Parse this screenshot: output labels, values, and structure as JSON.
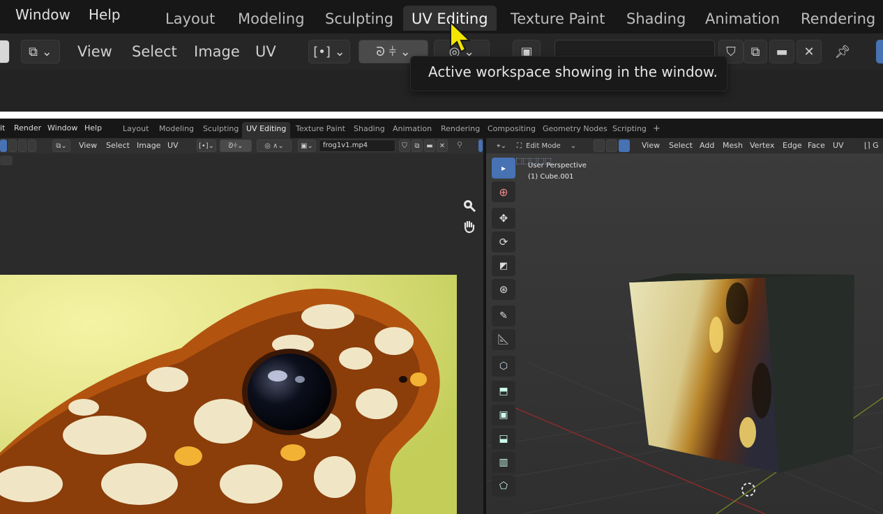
{
  "zoom": {
    "menu": [
      "Window",
      "Help"
    ],
    "tabs": [
      {
        "label": "Layout",
        "active": false
      },
      {
        "label": "Modeling",
        "active": false
      },
      {
        "label": "Sculpting",
        "active": false
      },
      {
        "label": "UV Editing",
        "active": true
      },
      {
        "label": "Texture Paint",
        "active": false
      },
      {
        "label": "Shading",
        "active": false
      },
      {
        "label": "Animation",
        "active": false
      },
      {
        "label": "Rendering",
        "active": false
      }
    ],
    "header_menus": [
      "View",
      "Select",
      "Image",
      "UV"
    ],
    "tooltip": "Active workspace showing in the window."
  },
  "topbar": {
    "menus": [
      "it",
      "Render",
      "Window",
      "Help"
    ],
    "tabs": [
      {
        "label": "Layout",
        "active": false
      },
      {
        "label": "Modeling",
        "active": false
      },
      {
        "label": "Sculpting",
        "active": false
      },
      {
        "label": "UV Editing",
        "active": true
      },
      {
        "label": "Texture Paint",
        "active": false
      },
      {
        "label": "Shading",
        "active": false
      },
      {
        "label": "Animation",
        "active": false
      },
      {
        "label": "Rendering",
        "active": false
      },
      {
        "label": "Compositing",
        "active": false
      },
      {
        "label": "Geometry Nodes",
        "active": false
      },
      {
        "label": "Scripting",
        "active": false
      }
    ],
    "add_tab": "+"
  },
  "uv_editor": {
    "menus": [
      "View",
      "Select",
      "Image",
      "UV"
    ],
    "image_name": "frog1v1.mp4"
  },
  "viewport": {
    "mode": "Edit Mode",
    "menus": [
      "View",
      "Select",
      "Add",
      "Mesh",
      "Vertex",
      "Edge",
      "Face",
      "UV"
    ],
    "overlay_line1": "User Perspective",
    "overlay_line2": "(1) Cube.001"
  },
  "colors": {
    "accent": "#4772b3",
    "tooltip_bg": "#191919",
    "cursor": "#f2e600"
  }
}
